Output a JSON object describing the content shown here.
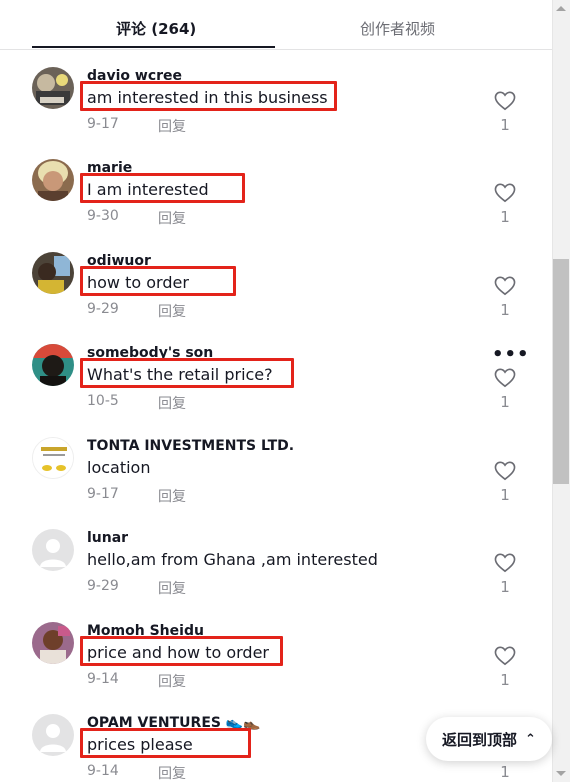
{
  "tabs": {
    "comments": "评论 (264)",
    "creator_videos": "创作者视频"
  },
  "comments": [
    {
      "username": "davio wcree",
      "text": "am interested in this business",
      "date": "9-17",
      "reply": "回复",
      "likes": "1",
      "highlighted": true
    },
    {
      "username": "marie",
      "text": "I am interested",
      "date": "9-30",
      "reply": "回复",
      "likes": "1",
      "highlighted": true
    },
    {
      "username": "odiwuor",
      "text": "how to order",
      "date": "9-29",
      "reply": "回复",
      "likes": "1",
      "highlighted": true
    },
    {
      "username": "somebody's son",
      "text": "What's the retail price?",
      "date": "10-5",
      "reply": "回复",
      "likes": "1",
      "highlighted": true,
      "more": "•••"
    },
    {
      "username": "TONTA INVESTMENTS LTD.",
      "text": "location",
      "date": "9-17",
      "reply": "回复",
      "likes": "1",
      "highlighted": false
    },
    {
      "username": "lunar",
      "text": "hello,am from Ghana ,am interested",
      "date": "9-29",
      "reply": "回复",
      "likes": "1",
      "highlighted": false
    },
    {
      "username": "Momoh Sheidu",
      "text": "price and how to order",
      "date": "9-14",
      "reply": "回复",
      "likes": "1",
      "highlighted": true
    },
    {
      "username": "OPAM VENTURES 👟👞",
      "text": "prices please",
      "date": "9-14",
      "reply": "回复",
      "likes": "1",
      "highlighted": true
    }
  ],
  "back_to_top": {
    "label": "返回到顶部",
    "icon": "double-chevron-up-icon"
  },
  "colors": {
    "highlight": "#e3231a",
    "muted": "#8a8b91",
    "text": "#161823"
  }
}
